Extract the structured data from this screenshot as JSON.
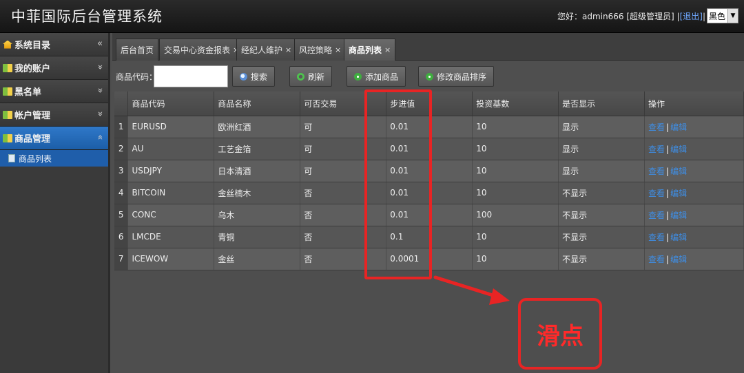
{
  "app": {
    "title": "中菲国际后台管理系统"
  },
  "header": {
    "greeting": "您好：",
    "username": "admin666",
    "role": "[超级管理员]",
    "sep": "|",
    "logout": "[退出]",
    "theme": "黑色"
  },
  "sidebar": {
    "items": [
      {
        "label": "系统目录",
        "chevron": "«"
      },
      {
        "label": "我的账户",
        "chevron": "»"
      },
      {
        "label": "黑名单",
        "chevron": "»"
      },
      {
        "label": "帐户管理",
        "chevron": "»"
      },
      {
        "label": "商品管理",
        "chevron": "«"
      }
    ],
    "sub_item": "商品列表"
  },
  "tabs": [
    {
      "label": "后台首页",
      "closable": false
    },
    {
      "label": "交易中心资金报表",
      "closable": true
    },
    {
      "label": "经纪人维护",
      "closable": true
    },
    {
      "label": "风控策略",
      "closable": true
    },
    {
      "label": "商品列表",
      "closable": true
    }
  ],
  "tab_close": "×",
  "toolbar": {
    "code_label": "商品代码：",
    "code_value": "",
    "search": "搜索",
    "refresh": "刷新",
    "add": "添加商品",
    "sort": "修改商品排序"
  },
  "table": {
    "columns": [
      "商品代码",
      "商品名称",
      "可否交易",
      "步进值",
      "投资基数",
      "是否显示",
      "操作"
    ],
    "rows": [
      {
        "num": "1",
        "code": "EURUSD",
        "name": "欧洲红酒",
        "trade": "可",
        "step": "0.01",
        "base": "10",
        "show": "显示"
      },
      {
        "num": "2",
        "code": "AU",
        "name": "工艺金箔",
        "trade": "可",
        "step": "0.01",
        "base": "10",
        "show": "显示"
      },
      {
        "num": "3",
        "code": "USDJPY",
        "name": "日本清酒",
        "trade": "可",
        "step": "0.01",
        "base": "10",
        "show": "显示"
      },
      {
        "num": "4",
        "code": "BITCOIN",
        "name": "金丝楠木",
        "trade": "否",
        "step": "0.01",
        "base": "10",
        "show": "不显示"
      },
      {
        "num": "5",
        "code": "CONC",
        "name": "乌木",
        "trade": "否",
        "step": "0.01",
        "base": "100",
        "show": "不显示"
      },
      {
        "num": "6",
        "code": "LMCDE",
        "name": "青铜",
        "trade": "否",
        "step": "0.1",
        "base": "10",
        "show": "不显示"
      },
      {
        "num": "7",
        "code": "ICEWOW",
        "name": "金丝",
        "trade": "否",
        "step": "0.0001",
        "base": "10",
        "show": "不显示"
      }
    ],
    "op_view": "查看",
    "op_edit": "编辑",
    "op_sep": "|"
  },
  "annotation": {
    "label": "滑点",
    "color": "#e82424"
  }
}
